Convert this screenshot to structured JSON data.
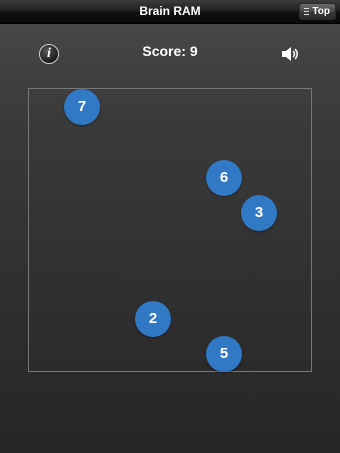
{
  "nav": {
    "title": "Brain RAM",
    "top_button_label": "Top",
    "top_button_icon": "list-icon"
  },
  "hud": {
    "info_label": "i",
    "info_icon": "info-icon",
    "score_text": "Score: 9",
    "sound_icon": "speaker-icon"
  },
  "board": {
    "tiles": [
      {
        "number": "7"
      },
      {
        "number": "6"
      },
      {
        "number": "3"
      },
      {
        "number": "2"
      },
      {
        "number": "5"
      }
    ]
  },
  "colors": {
    "tile_blue": "#3179c4",
    "board_border": "#777777"
  }
}
